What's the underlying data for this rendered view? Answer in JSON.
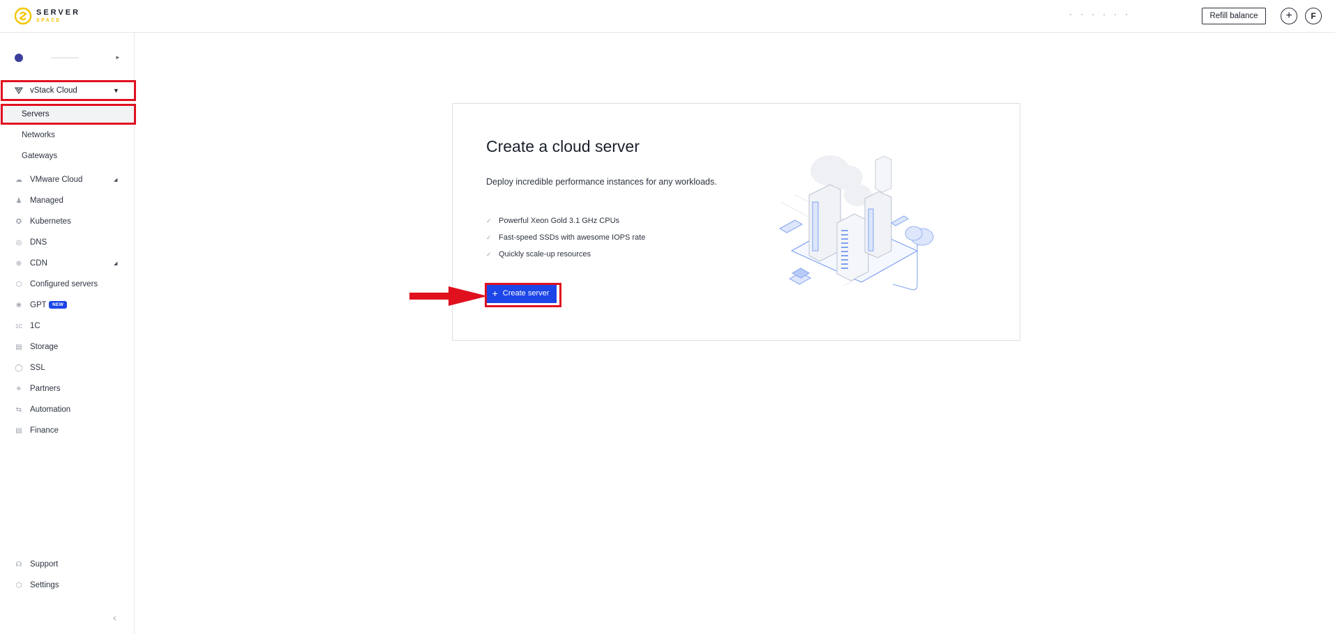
{
  "brand": {
    "line1": "SERVER",
    "line2": "SPACE",
    "accent": "#f3c400"
  },
  "header": {
    "refill_label": "Refill balance",
    "add_icon": "plus-icon",
    "avatar_letter": "F"
  },
  "sidebar": {
    "groups": {
      "vstack": {
        "label": "vStack Cloud",
        "icon": "vstack-icon"
      },
      "vstack_children": [
        {
          "label": "Servers"
        },
        {
          "label": "Networks"
        },
        {
          "label": "Gateways"
        }
      ]
    },
    "items": [
      {
        "label": "VMware Cloud",
        "icon": "cloud-icon"
      },
      {
        "label": "Managed",
        "icon": "user-icon"
      },
      {
        "label": "Kubernetes",
        "icon": "kubernetes-icon"
      },
      {
        "label": "DNS",
        "icon": "dns-icon"
      },
      {
        "label": "CDN",
        "icon": "globe-icon"
      },
      {
        "label": "Configured servers",
        "icon": "hexagon-icon"
      },
      {
        "label": "GPT",
        "icon": "gpt-icon",
        "badge": "NEW"
      },
      {
        "label": "1C",
        "icon": "onec-icon"
      },
      {
        "label": "Storage",
        "icon": "storage-icon"
      },
      {
        "label": "SSL",
        "icon": "shield-icon"
      },
      {
        "label": "Partners",
        "icon": "partners-icon"
      },
      {
        "label": "Automation",
        "icon": "automation-icon"
      },
      {
        "label": "Finance",
        "icon": "document-icon"
      }
    ],
    "bottom": [
      {
        "label": "Support",
        "icon": "headset-icon"
      },
      {
        "label": "Settings",
        "icon": "gear-icon"
      }
    ]
  },
  "main": {
    "title": "Create a cloud server",
    "description": "Deploy incredible performance instances for any workloads.",
    "features": [
      "Powerful Xeon Gold 3.1 GHz CPUs",
      "Fast-speed SSDs with awesome IOPS rate",
      "Quickly scale-up resources"
    ],
    "create_label": "Create server"
  },
  "colors": {
    "primary": "#1c46e8",
    "highlight": "#e0101f"
  }
}
